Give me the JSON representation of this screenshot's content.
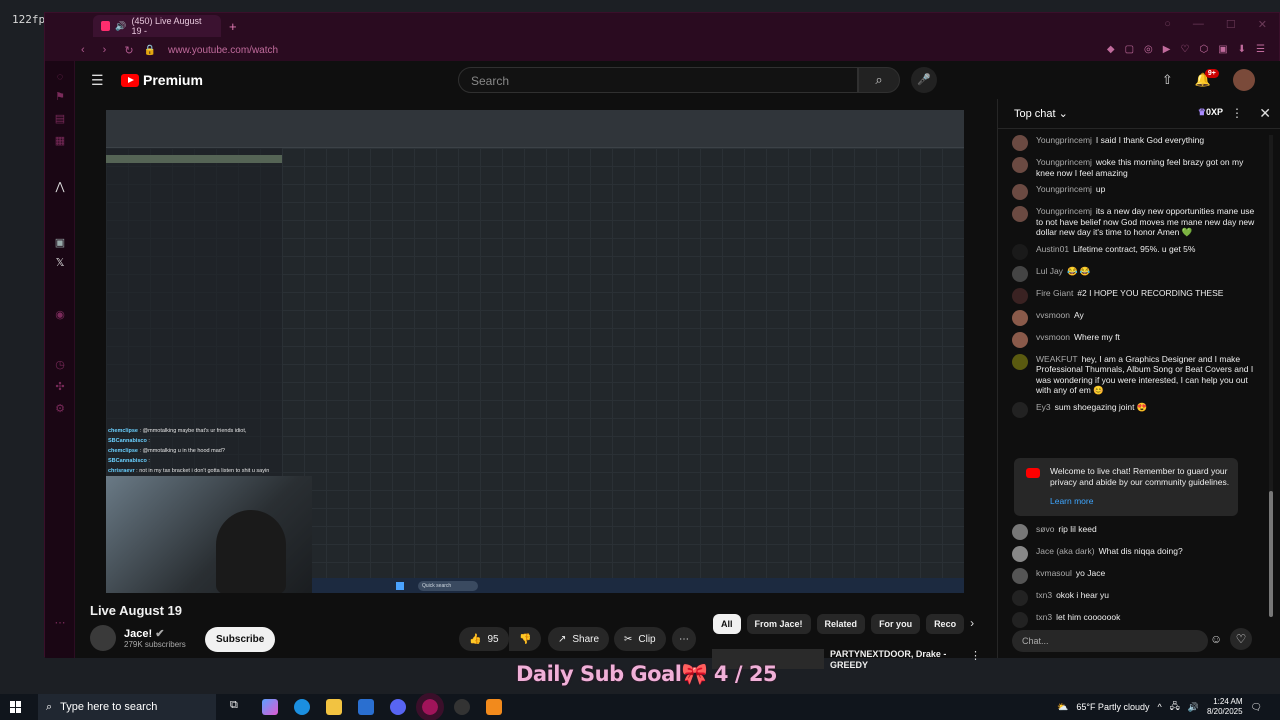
{
  "overlay": {
    "fps": "122fp",
    "goal_text": "Daily Sub Goal🎀 4 / 25"
  },
  "browser": {
    "tab_title": "(450) Live August 19 -",
    "url": "www.youtube.com/watch"
  },
  "youtube": {
    "logo": "Premium",
    "search_placeholder": "Search",
    "notif_count": "9+"
  },
  "video": {
    "stream_chat": [
      {
        "user": "chemclipse",
        "text": ": @mmotalking maybe that's ur friends idiot,"
      },
      {
        "user": "SBCannabisco",
        "text": ":"
      },
      {
        "user": "chemclipse",
        "text": ": @mmotalking u in the hood mad?"
      },
      {
        "user": "SBCannabisco",
        "text": ":"
      },
      {
        "user": "chrisraevr",
        "text": ": not in my tax bracket i don't gotta listen to shit u sayin"
      }
    ],
    "mini_search": "Quick search"
  },
  "info": {
    "title": "Live August 19",
    "channel": "Jace!",
    "subs": "279K subscribers",
    "subscribe": "Subscribe",
    "likes": "95",
    "share": "Share",
    "clip": "Clip"
  },
  "chips": [
    "All",
    "From Jace!",
    "Related",
    "For you",
    "Reco"
  ],
  "rec": {
    "title": "PARTYNEXTDOOR, Drake - GREEDY"
  },
  "livechat": {
    "header": "Top chat",
    "xp": "0XP",
    "messages": [
      {
        "author": "Youngprincemj",
        "text": "I said I thank God everything"
      },
      {
        "author": "Youngprincemj",
        "text": "woke this morning feel brazy got on my knee now I feel amazing"
      },
      {
        "author": "Youngprincemj",
        "text": "up"
      },
      {
        "author": "Youngprincemj",
        "text": "its a new day new opportunities mane use to not have belief now God moves me mane new day new dollar new day it's time to honor Amen 💚"
      },
      {
        "author": "Austin01",
        "text": "Lifetime contract, 95%. u get 5%"
      },
      {
        "author": "Lul Jay",
        "text": "😂 😂"
      },
      {
        "author": "Fire Giant",
        "text": "#2 I HOPE YOU RECORDING THESE"
      },
      {
        "author": "vvsmoon",
        "text": "Ay"
      },
      {
        "author": "vvsmoon",
        "text": "Where my ft"
      },
      {
        "author": "WEAKFUT",
        "text": "hey, I am a Graphics Designer and I make Professional Thumnals, Album Song or Beat Covers and I was wondering if you were interested, I can help you out with any of em 😊"
      },
      {
        "author": "Ey3",
        "text": "sum shoegazing joint 😍"
      }
    ],
    "notice": "Welcome to live chat! Remember to guard your privacy and abide by our community guidelines.",
    "learn_more": "Learn more",
    "messages2": [
      {
        "author": "søvo",
        "text": "rip lil keed"
      },
      {
        "author": "Jace (aka dark)",
        "text": "What dis niqqa doing?"
      },
      {
        "author": "kvmasoul",
        "text": "yo Jace"
      },
      {
        "author": "txn3",
        "text": "okok i hear yu"
      },
      {
        "author": "txn3",
        "text": "let him cooooook"
      }
    ],
    "input_placeholder": "Chat..."
  },
  "taskbar": {
    "search": "Type here to search",
    "weather": "65°F  Partly cloudy",
    "time": "1:24 AM",
    "date": "8/20/2025"
  },
  "colors": {
    "accent": "#ff0000",
    "browser_frame": "#2a0b20",
    "link": "#3ea6ff"
  }
}
